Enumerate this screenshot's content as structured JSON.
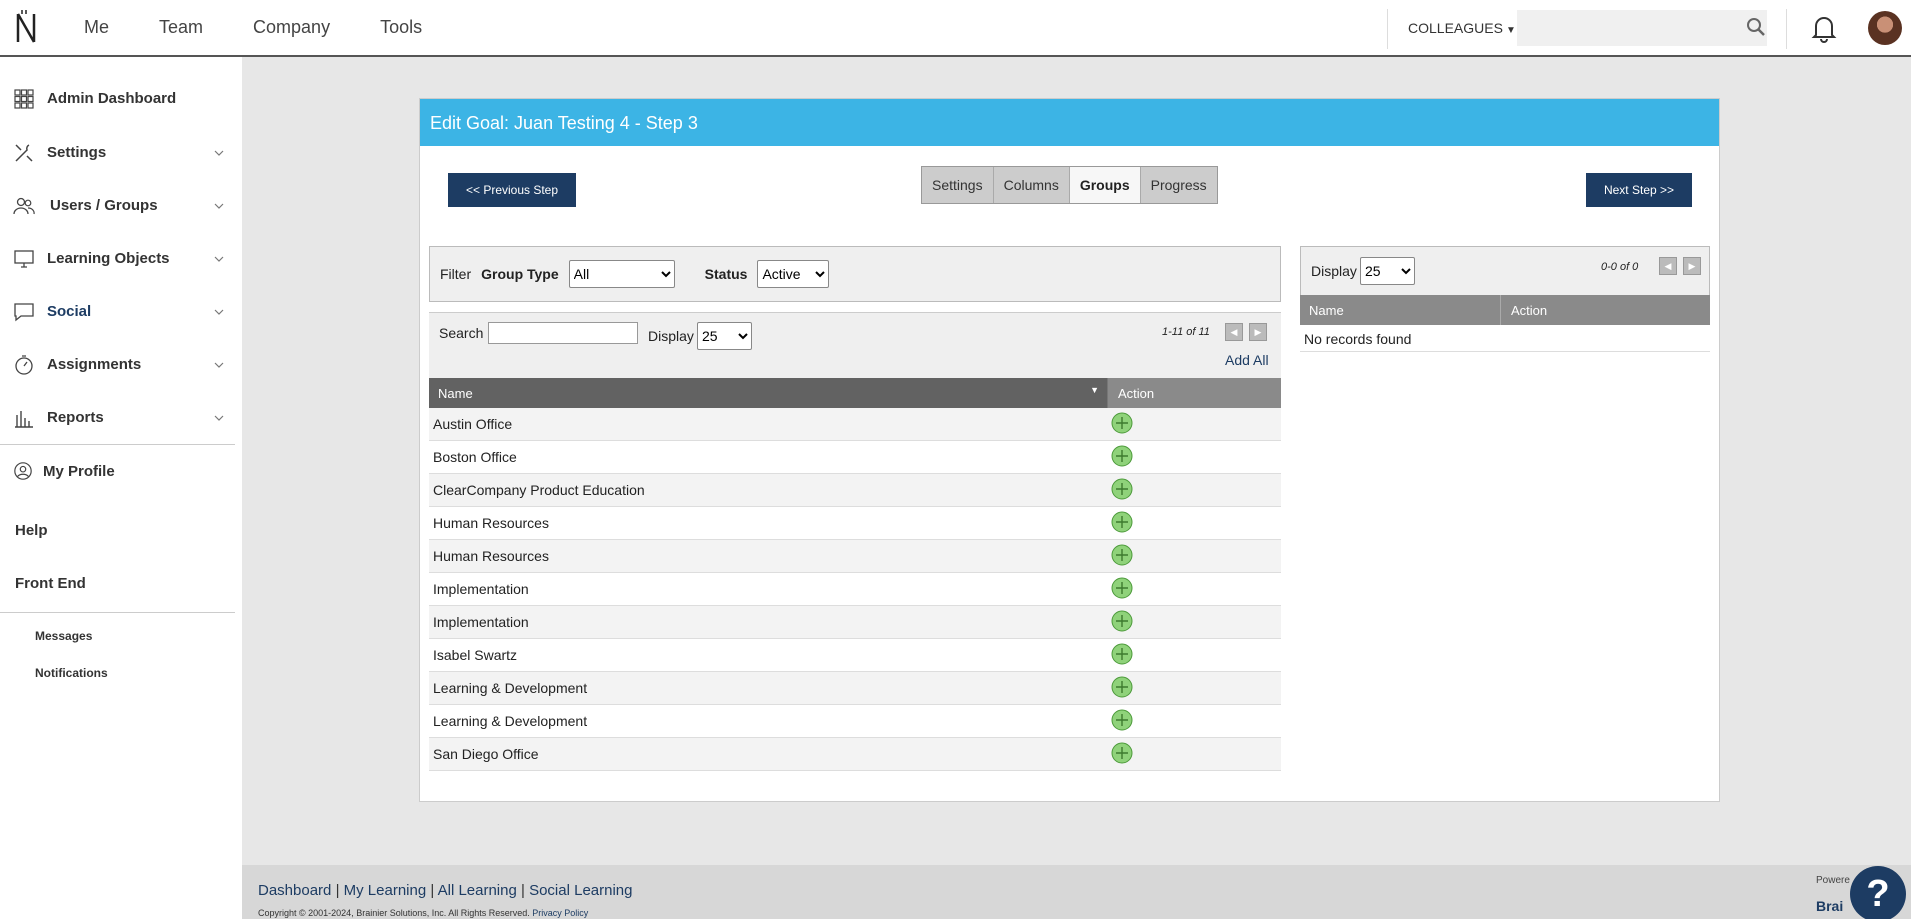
{
  "topnav": {
    "items": [
      "Me",
      "Team",
      "Company",
      "Tools"
    ]
  },
  "header": {
    "colleagues_label": "COLLEAGUES",
    "search_placeholder": ""
  },
  "sidebar": {
    "items": [
      {
        "label": "Admin Dashboard",
        "icon": "grid-icon"
      },
      {
        "label": "Settings",
        "icon": "tools-icon"
      },
      {
        "label": "Users / Groups",
        "icon": "users-icon"
      },
      {
        "label": "Learning Objects",
        "icon": "monitor-icon"
      },
      {
        "label": "Social",
        "icon": "chat-icon"
      },
      {
        "label": "Assignments",
        "icon": "stopwatch-icon"
      },
      {
        "label": "Reports",
        "icon": "bar-chart-icon"
      }
    ],
    "my_profile": "My Profile",
    "help": "Help",
    "front_end": "Front End",
    "messages": "Messages",
    "notifications": "Notifications"
  },
  "panel": {
    "title": "Edit Goal: Juan Testing 4 - Step 3",
    "prev_step": "<< Previous Step",
    "next_step": "Next Step >>",
    "tabs": [
      "Settings",
      "Columns",
      "Groups",
      "Progress"
    ],
    "active_tab": "Groups",
    "filter": {
      "label": "Filter",
      "group_type_label": "Group Type",
      "group_type_value": "All",
      "status_label": "Status",
      "status_value": "Active"
    },
    "list": {
      "search_label": "Search",
      "display_label": "Display",
      "display_value": "25",
      "count_text": "1-11 of 11",
      "add_all": "Add All",
      "col_name": "Name",
      "col_action": "Action",
      "rows": [
        "Austin Office",
        "Boston Office",
        "ClearCompany Product Education",
        "Human Resources",
        "Human Resources",
        "Implementation",
        "Implementation",
        "Isabel Swartz",
        "Learning & Development",
        "Learning & Development",
        "San Diego Office"
      ]
    },
    "selected": {
      "display_label": "Display",
      "display_value": "25",
      "count_text": "0-0 of 0",
      "col_name": "Name",
      "col_action": "Action",
      "empty_text": "No records found"
    }
  },
  "footer": {
    "links": [
      "Dashboard",
      "My Learning",
      "All Learning",
      "Social Learning"
    ],
    "copyright": "Copyright © 2001-2024, Brainier Solutions, Inc. All Rights Reserved.",
    "privacy": "Privacy Policy",
    "powered": "Powere",
    "brand": "Brai"
  },
  "colors": {
    "header_blue": "#3cb4e5",
    "dark_navy": "#1d3c63",
    "add_green": "#8fd27a"
  }
}
